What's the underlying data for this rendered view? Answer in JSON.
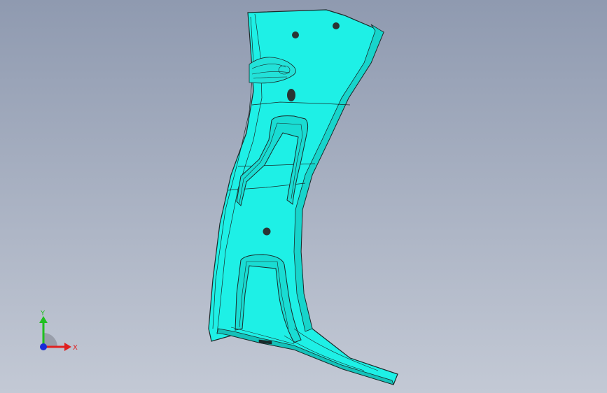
{
  "viewport": {
    "background_top": "#8f9ab0",
    "background_bottom": "#c3c9d5"
  },
  "model": {
    "surface_color": "#1ef0e6",
    "edge_color": "#1a2a2a",
    "hole_color": "#2a3434"
  },
  "triad": {
    "x_label": "X",
    "y_label": "Y",
    "x_color": "#e02020",
    "y_color": "#20c020",
    "z_color": "#1a2ad8"
  }
}
